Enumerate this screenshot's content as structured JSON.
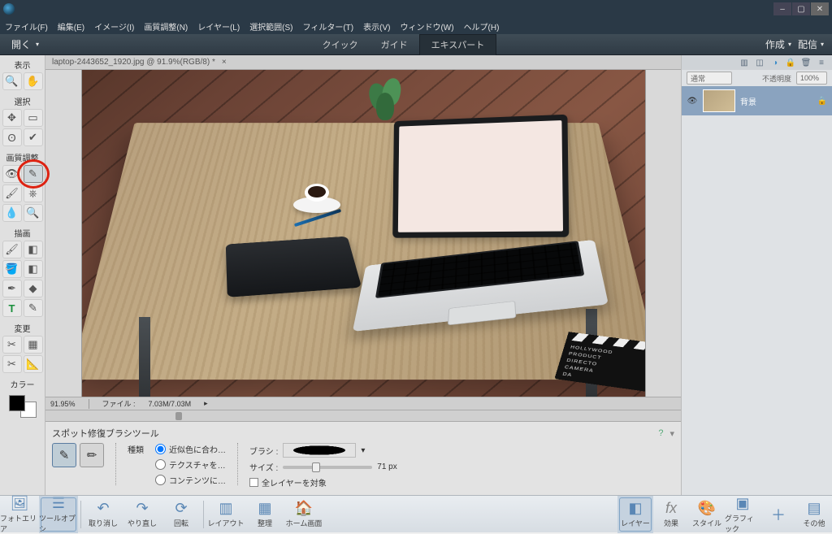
{
  "menu": {
    "file": "ファイル(F)",
    "edit": "編集(E)",
    "image": "イメージ(I)",
    "adjust": "画質調整(N)",
    "layer": "レイヤー(L)",
    "select": "選択範囲(S)",
    "filter": "フィルター(T)",
    "view": "表示(V)",
    "window": "ウィンドウ(W)",
    "help": "ヘルプ(H)"
  },
  "topbar": {
    "open": "開く",
    "tab_quick": "クイック",
    "tab_guide": "ガイド",
    "tab_expert": "エキスパート",
    "create": "作成",
    "deliver": "配信"
  },
  "document": {
    "tab": "laptop-2443652_1920.jpg @ 91.9%(RGB/8) *",
    "zoom": "91.95%",
    "file_label": "ファイル :",
    "file_size": "7.03M/7.03M"
  },
  "clapper": {
    "l1": "HOLLYWOOD",
    "l2": "PRODUCT",
    "l3": "DIRECTO",
    "l4": "CAMERA",
    "l5": "DA"
  },
  "tool": {
    "sec_view": "表示",
    "sec_select": "選択",
    "sec_adjust": "画質調整",
    "sec_draw": "描画",
    "sec_mod": "変更",
    "sec_color": "カラー"
  },
  "options": {
    "title": "スポット修復ブラシツール",
    "type_label": "種類",
    "opt_proximity": "近似色に合わ…",
    "opt_texture": "テクスチャを…",
    "opt_content": "コンテンツに…",
    "brush_label": "ブラシ :",
    "size_label": "サイズ :",
    "size_value": "71 px",
    "all_layers": "全レイヤーを対象"
  },
  "layers": {
    "blend": "通常",
    "opacity_label": "不透明度",
    "opacity_value": "100%",
    "layer_name": "背景"
  },
  "bottombar": {
    "photo": "フォトエリア",
    "toolopt": "ツールオプシ…",
    "undo": "取り消し",
    "redo": "やり直し",
    "rotate": "回転",
    "layout": "レイアウト",
    "organize": "整理",
    "home": "ホーム画面",
    "layers": "レイヤー",
    "effects": "効果",
    "styles": "スタイル",
    "graphics": "グラフィック",
    "other": "その他"
  }
}
